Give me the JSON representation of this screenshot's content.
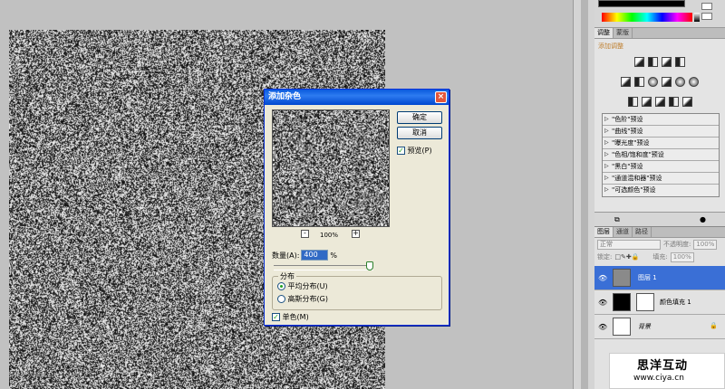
{
  "dialog": {
    "title": "添加杂色",
    "ok_label": "确定",
    "cancel_label": "取消",
    "preview_label": "预览(P)",
    "zoom_level": "100%",
    "zoom_out": "-",
    "zoom_in": "+",
    "amount_label": "数量(A):",
    "amount_value": "400",
    "amount_unit": "%",
    "distribution_label": "分布",
    "uniform_label": "平均分布(U)",
    "gaussian_label": "高斯分布(G)",
    "mono_label": "单色(M)",
    "preview_checked": true,
    "uniform_selected": true,
    "mono_checked": true
  },
  "adjustments": {
    "tabs": [
      "调整",
      "蒙版"
    ],
    "title": "添加调整",
    "presets": [
      "\"色阶\"预设",
      "\"曲线\"预设",
      "\"曝光度\"预设",
      "\"色相/饱和度\"预设",
      "\"黑白\"预设",
      "\"通道混和器\"预设",
      "\"可选颜色\"预设"
    ]
  },
  "layers": {
    "tabs": [
      "图层",
      "通道",
      "路径"
    ],
    "blend_mode": "正常",
    "opacity_label": "不透明度:",
    "opacity_value": "100%",
    "lock_label": "锁定:",
    "fill_label": "填充:",
    "fill_value": "100%",
    "items": [
      {
        "name": "图层 1"
      },
      {
        "name": "颜色填充 1"
      },
      {
        "name": "背景"
      }
    ]
  },
  "watermark": {
    "name": "思洋互动",
    "url": "www.ciya.cn"
  }
}
